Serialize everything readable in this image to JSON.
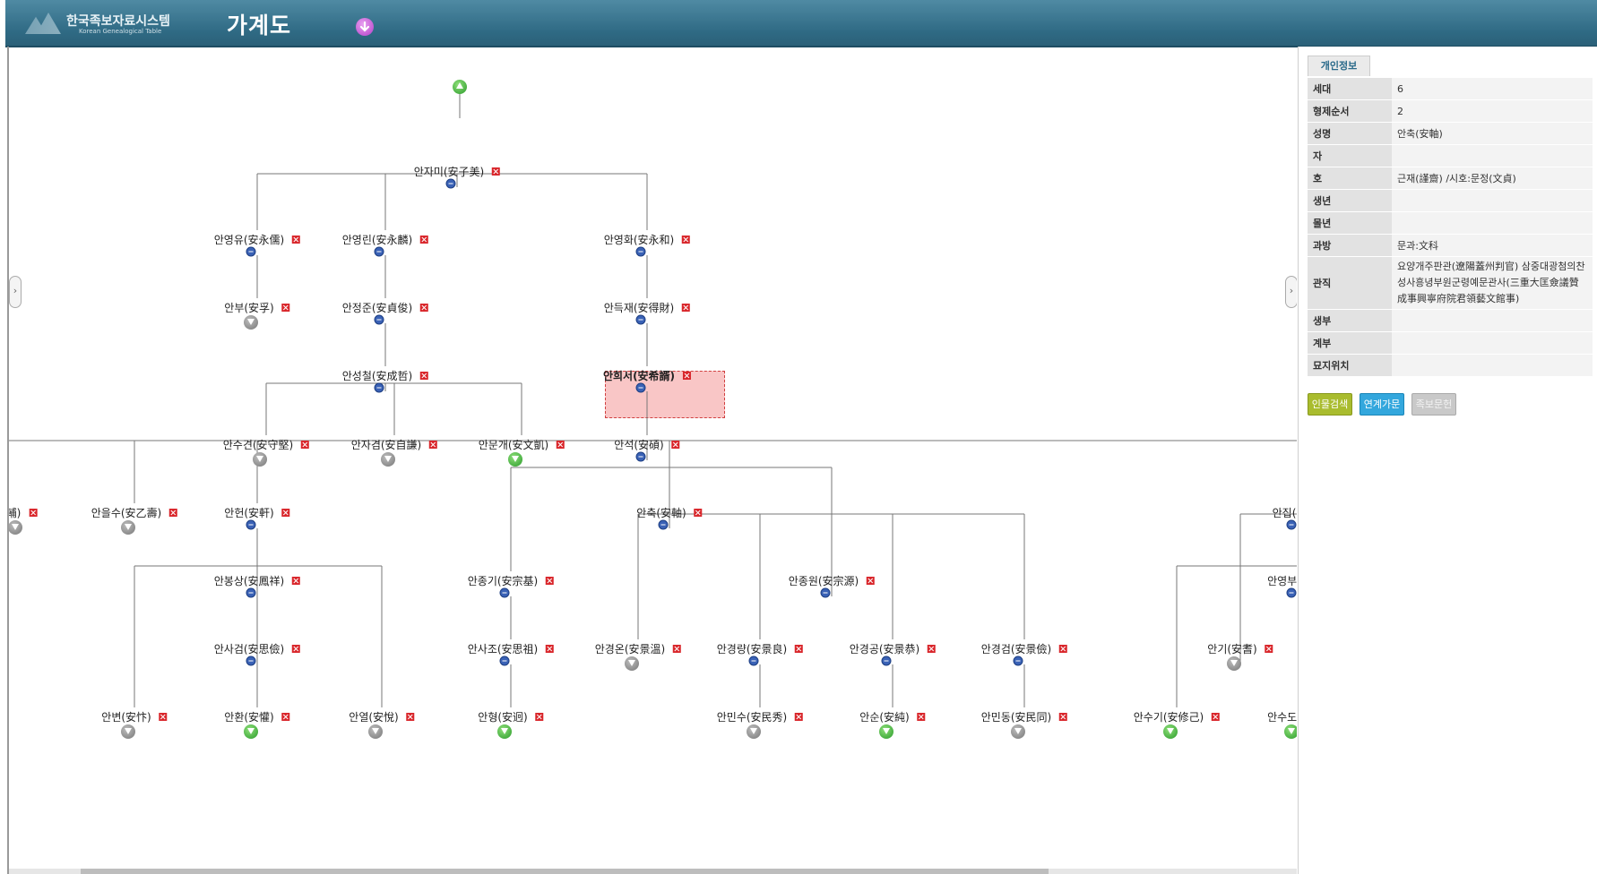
{
  "header": {
    "logo_name": "한국족보자료시스템",
    "logo_sub": "Korean Genealogical Table",
    "title": "가계도"
  },
  "tree": {
    "nodes": [
      {
        "name": "안자미(安子美)"
      },
      {
        "name": "안영유(安永儒)"
      },
      {
        "name": "안영린(安永麟)"
      },
      {
        "name": "안영화(安永和)"
      },
      {
        "name": "안부(安孚)"
      },
      {
        "name": "안정준(安貞俊)"
      },
      {
        "name": "안득재(安得財)"
      },
      {
        "name": "안성철(安成哲)"
      },
      {
        "name": "안희서(安希諝)"
      },
      {
        "name": "안수견(安守堅)"
      },
      {
        "name": "안자겸(安自謙)"
      },
      {
        "name": "안문개(安文凱)"
      },
      {
        "name": "안석(安碩)"
      },
      {
        "name": "輔)"
      },
      {
        "name": "안을수(安乙壽)"
      },
      {
        "name": "안헌(安軒)"
      },
      {
        "name": "안축(安軸)"
      },
      {
        "name": "안집(安"
      },
      {
        "name": "안봉상(安鳳祥)"
      },
      {
        "name": "안종기(安宗基)"
      },
      {
        "name": "안종원(安宗源)"
      },
      {
        "name": "안영부(安"
      },
      {
        "name": "안사검(安思儉)"
      },
      {
        "name": "안사조(安思祖)"
      },
      {
        "name": "안경온(安景溫)"
      },
      {
        "name": "안경량(安景良)"
      },
      {
        "name": "안경공(安景恭)"
      },
      {
        "name": "안경검(安景儉)"
      },
      {
        "name": "안기(安耆)"
      },
      {
        "name": "안변(安忭)"
      },
      {
        "name": "안환(安懽)"
      },
      {
        "name": "안열(安悅)"
      },
      {
        "name": "안형(安迥)"
      },
      {
        "name": "안민수(安民秀)"
      },
      {
        "name": "안순(安純)"
      },
      {
        "name": "안민동(安民同)"
      },
      {
        "name": "안수기(安修己)"
      },
      {
        "name": "안수도(安"
      }
    ]
  },
  "panel": {
    "tab": "개인정보",
    "rows": [
      {
        "label": "세대",
        "value": "6"
      },
      {
        "label": "형제순서",
        "value": "2"
      },
      {
        "label": "성명",
        "value": "안축(安軸)"
      },
      {
        "label": "자",
        "value": ""
      },
      {
        "label": "호",
        "value": "근재(謹齋) /시호:문정(文貞)"
      },
      {
        "label": "생년",
        "value": ""
      },
      {
        "label": "몰년",
        "value": ""
      },
      {
        "label": "과방",
        "value": "문과:文科"
      },
      {
        "label": "관직",
        "value": "요양개주판관(遼陽蓋州判官) 삼중대광첨의찬성사흥녕부원군령예문관사(三重大匡僉議贊成事興寧府院君領藝文館事)"
      },
      {
        "label": "생부",
        "value": ""
      },
      {
        "label": "계부",
        "value": ""
      },
      {
        "label": "묘지위치",
        "value": ""
      }
    ],
    "buttons": {
      "search": "인물검색",
      "link": "연계가문",
      "doc": "족보문헌"
    }
  },
  "colors": {
    "header": "#3a7893",
    "selected": "#f9c6c6",
    "delete": "#d9262b",
    "expand_green": "#2a9a2a",
    "expand_gray": "#777777"
  }
}
